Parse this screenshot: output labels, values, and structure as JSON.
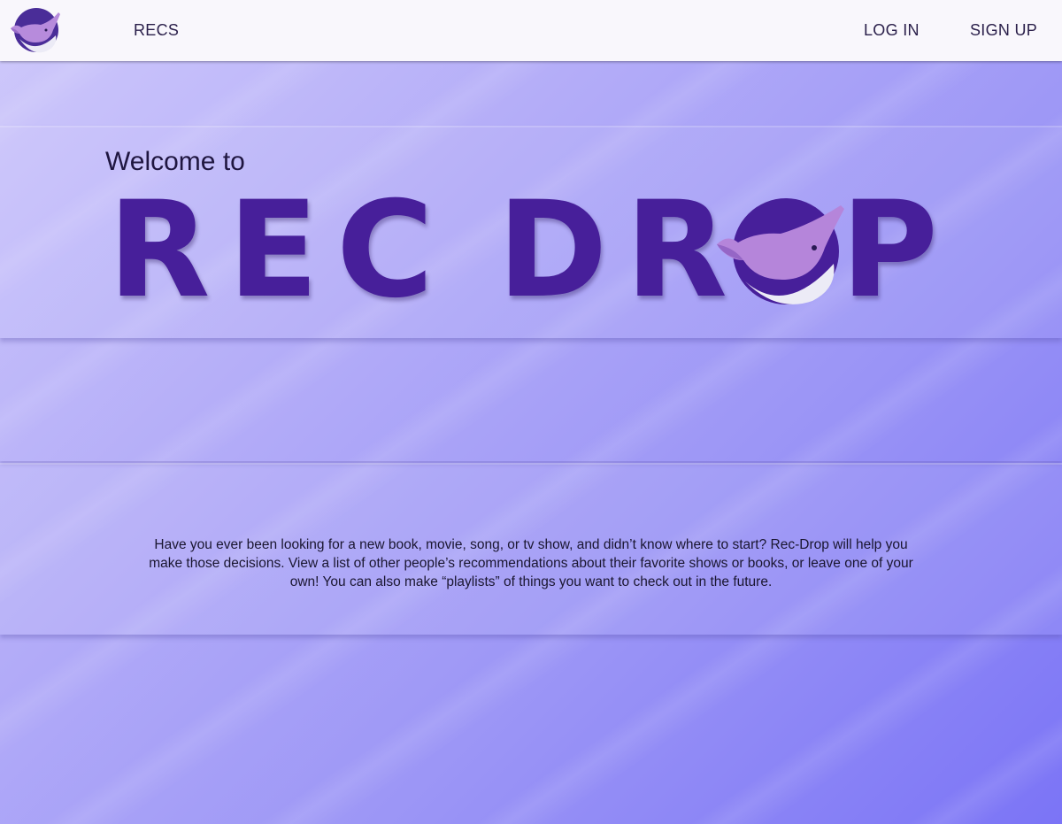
{
  "nav": {
    "logo_icon": "narwhal-logo-icon",
    "recs_label": "RECS",
    "login_label": "LOG IN",
    "signup_label": "SIGN UP"
  },
  "hero": {
    "welcome": "Welcome to",
    "brand_part1": "REC",
    "brand_part2": "DR",
    "brand_part3": "P",
    "brand_o_icon": "narwhal-o-icon"
  },
  "description": "Have you ever been looking for a new book, movie, song, or tv show, and didn’t know where to start? Rec-Drop will help you make those decisions. View a list of other people’s recommendations about their favorite shows or books, or leave one of your own! You can also make “playlists” of things you want to check out in the future.",
  "colors": {
    "brand": "#471f9a",
    "navbar": "#f9f7fc",
    "background_start": "#cfc9fb",
    "background_end": "#7b74f6"
  }
}
